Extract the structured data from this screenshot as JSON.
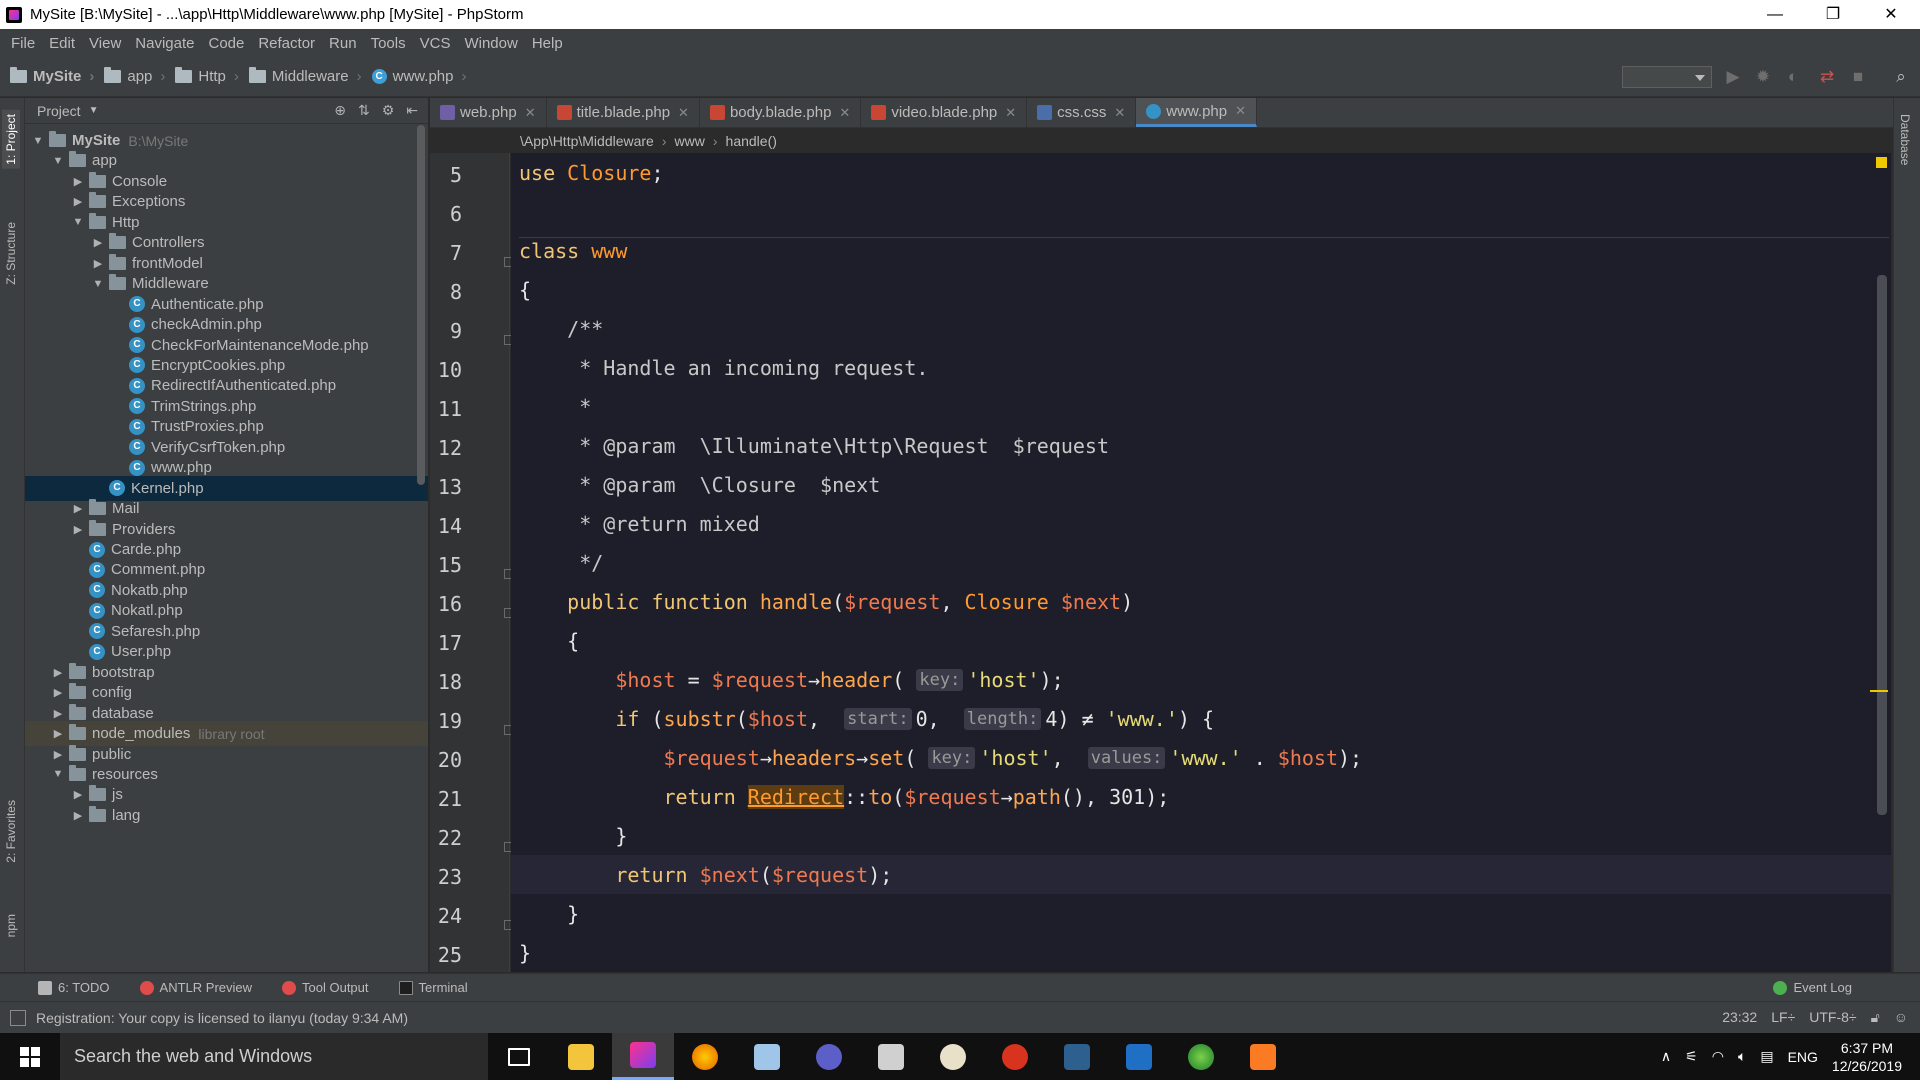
{
  "window": {
    "title": "MySite [B:\\MySite] - ...\\app\\Http\\Middleware\\www.php [MySite] - PhpStorm",
    "minimize": "—",
    "restore": "❐",
    "close": "✕"
  },
  "menu": [
    "File",
    "Edit",
    "View",
    "Navigate",
    "Code",
    "Refactor",
    "Run",
    "Tools",
    "VCS",
    "Window",
    "Help"
  ],
  "navbar": {
    "crumbs": [
      "MySite",
      "app",
      "Http",
      "Middleware",
      "www.php"
    ]
  },
  "left_stripe": {
    "project": "1: Project",
    "structure": "Z: Structure",
    "favorites": "2: Favorites",
    "npm": "npm"
  },
  "right_stripe": {
    "database": "Database"
  },
  "project_panel": {
    "header": "Project",
    "tree": [
      {
        "label": "MySite",
        "hint": "B:\\MySite",
        "depth": 0,
        "type": "folder",
        "open": true,
        "bold": true
      },
      {
        "label": "app",
        "depth": 1,
        "type": "folder",
        "open": true
      },
      {
        "label": "Console",
        "depth": 2,
        "type": "folder",
        "open": false
      },
      {
        "label": "Exceptions",
        "depth": 2,
        "type": "folder",
        "open": false
      },
      {
        "label": "Http",
        "depth": 2,
        "type": "folder",
        "open": true
      },
      {
        "label": "Controllers",
        "depth": 3,
        "type": "folder",
        "open": false
      },
      {
        "label": "frontModel",
        "depth": 3,
        "type": "folder",
        "open": false
      },
      {
        "label": "Middleware",
        "depth": 3,
        "type": "folder",
        "open": true
      },
      {
        "label": "Authenticate.php",
        "depth": 4,
        "type": "class"
      },
      {
        "label": "checkAdmin.php",
        "depth": 4,
        "type": "class"
      },
      {
        "label": "CheckForMaintenanceMode.php",
        "depth": 4,
        "type": "class"
      },
      {
        "label": "EncryptCookies.php",
        "depth": 4,
        "type": "class"
      },
      {
        "label": "RedirectIfAuthenticated.php",
        "depth": 4,
        "type": "class"
      },
      {
        "label": "TrimStrings.php",
        "depth": 4,
        "type": "class"
      },
      {
        "label": "TrustProxies.php",
        "depth": 4,
        "type": "class"
      },
      {
        "label": "VerifyCsrfToken.php",
        "depth": 4,
        "type": "class"
      },
      {
        "label": "www.php",
        "depth": 4,
        "type": "class"
      },
      {
        "label": "Kernel.php",
        "depth": 3,
        "type": "class",
        "selected": true
      },
      {
        "label": "Mail",
        "depth": 2,
        "type": "folder",
        "open": false
      },
      {
        "label": "Providers",
        "depth": 2,
        "type": "folder",
        "open": false
      },
      {
        "label": "Carde.php",
        "depth": 2,
        "type": "class"
      },
      {
        "label": "Comment.php",
        "depth": 2,
        "type": "class"
      },
      {
        "label": "Nokatb.php",
        "depth": 2,
        "type": "class"
      },
      {
        "label": "Nokatl.php",
        "depth": 2,
        "type": "class"
      },
      {
        "label": "Sefaresh.php",
        "depth": 2,
        "type": "class"
      },
      {
        "label": "User.php",
        "depth": 2,
        "type": "class"
      },
      {
        "label": "bootstrap",
        "depth": 1,
        "type": "folder",
        "open": false
      },
      {
        "label": "config",
        "depth": 1,
        "type": "folder",
        "open": false
      },
      {
        "label": "database",
        "depth": 1,
        "type": "folder",
        "open": false
      },
      {
        "label": "node_modules",
        "hint": "library root",
        "depth": 1,
        "type": "folder",
        "open": false,
        "highlight": true
      },
      {
        "label": "public",
        "depth": 1,
        "type": "folder",
        "open": false
      },
      {
        "label": "resources",
        "depth": 1,
        "type": "folder",
        "open": true
      },
      {
        "label": "js",
        "depth": 2,
        "type": "folder",
        "open": false
      },
      {
        "label": "lang",
        "depth": 2,
        "type": "folder",
        "open": false
      }
    ]
  },
  "tabs": [
    {
      "label": "web.php",
      "icon": "php-file-icon",
      "active": false
    },
    {
      "label": "title.blade.php",
      "icon": "blade-file-icon",
      "active": false
    },
    {
      "label": "body.blade.php",
      "icon": "blade-file-icon",
      "active": false
    },
    {
      "label": "video.blade.php",
      "icon": "blade-file-icon",
      "active": false
    },
    {
      "label": "css.css",
      "icon": "css-file-icon",
      "active": false
    },
    {
      "label": "www.php",
      "icon": "php-class-icon",
      "active": true
    }
  ],
  "editor_breadcrumb": [
    "\\App\\Http\\Middleware",
    "www",
    "handle()"
  ],
  "code": {
    "line_numbers": [
      "5",
      "6",
      "7",
      "8",
      "9",
      "10",
      "11",
      "12",
      "13",
      "14",
      "15",
      "16",
      "17",
      "18",
      "19",
      "20",
      "21",
      "22",
      "23",
      "24",
      "25"
    ],
    "current_line": "23"
  },
  "bottom_tools": {
    "todo": "6: TODO",
    "antlr": "ANTLR Preview",
    "tool_output": "Tool Output",
    "terminal": "Terminal",
    "event_log": "Event Log"
  },
  "status": {
    "message": "Registration: Your copy is licensed to ilanyu (today 9:34 AM)",
    "position": "23:32",
    "line_sep": "LF÷",
    "encoding": "UTF-8÷"
  },
  "taskbar": {
    "search_placeholder": "Search the web and Windows",
    "language": "ENG",
    "time": "6:37 PM",
    "date": "12/26/2019"
  }
}
